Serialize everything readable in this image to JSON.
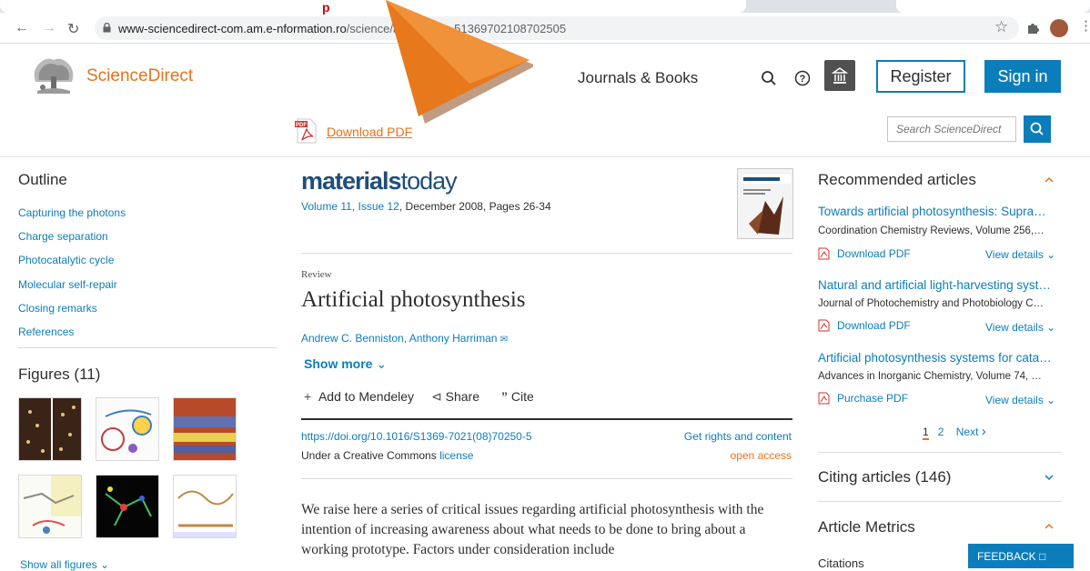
{
  "browser": {
    "url_host": "www-sciencedirect-com.am.e-nformation.ro",
    "url_path_visible": "/science/art",
    "url_path_tail": "51369702108702505"
  },
  "header": {
    "brand": "ScienceDirect",
    "journals_books": "Journals & Books",
    "register": "Register",
    "sign_in": "Sign in",
    "download_pdf": "Download PDF",
    "search_placeholder": "Search ScienceDirect"
  },
  "outline": {
    "heading": "Outline",
    "items": [
      "Capturing the photons",
      "Charge separation",
      "Photocatalytic cycle",
      "Molecular self-repair",
      "Closing remarks",
      "References"
    ]
  },
  "figures": {
    "heading": "Figures (11)",
    "show_all": "Show all figures"
  },
  "article": {
    "journal_logo_bold": "materials",
    "journal_logo_light": "today",
    "volume_link": "Volume 11, Issue 12",
    "volume_rest": ", December 2008, Pages 26-34",
    "type": "Review",
    "title": "Artificial photosynthesis",
    "authors": "Andrew C. Benniston, Anthony Harriman",
    "show_more": "Show more",
    "add_mendeley": "Add to Mendeley",
    "share": "Share",
    "cite": "Cite",
    "doi": "https://doi.org/10.1016/S1369-7021(08)70250-5",
    "rights": "Get rights and content",
    "cc_prefix": "Under a Creative Commons ",
    "cc_link": "license",
    "open_access": "open access",
    "abstract": "We raise here a series of critical issues regarding artificial photosynthesis with the intention of increasing awareness about what needs to be done to bring about a working prototype. Factors under consideration include"
  },
  "recommended": {
    "heading": "Recommended articles",
    "items": [
      {
        "title": "Towards artificial photosynthesis: Supra…",
        "source": "Coordination Chemistry Reviews, Volume 256,…",
        "pdf": "Download PDF",
        "view": "View details"
      },
      {
        "title": "Natural and artificial light-harvesting syst…",
        "source": "Journal of Photochemistry and Photobiology C…",
        "pdf": "Download PDF",
        "view": "View details"
      },
      {
        "title": "Artificial photosynthesis systems for cata…",
        "source": "Advances in Inorganic Chemistry, Volume 74, …",
        "pdf": "Purchase PDF",
        "view": "View details"
      }
    ],
    "pages": [
      "1",
      "2"
    ],
    "next": "Next"
  },
  "citing": {
    "heading": "Citing articles (146)"
  },
  "metrics": {
    "heading": "Article Metrics",
    "citations": "Citations"
  },
  "feedback": "FEEDBACK",
  "colors": {
    "brand_orange": "#e9711c",
    "link_blue": "#0c7dbb",
    "overlay_arrow": "#e8781c"
  }
}
